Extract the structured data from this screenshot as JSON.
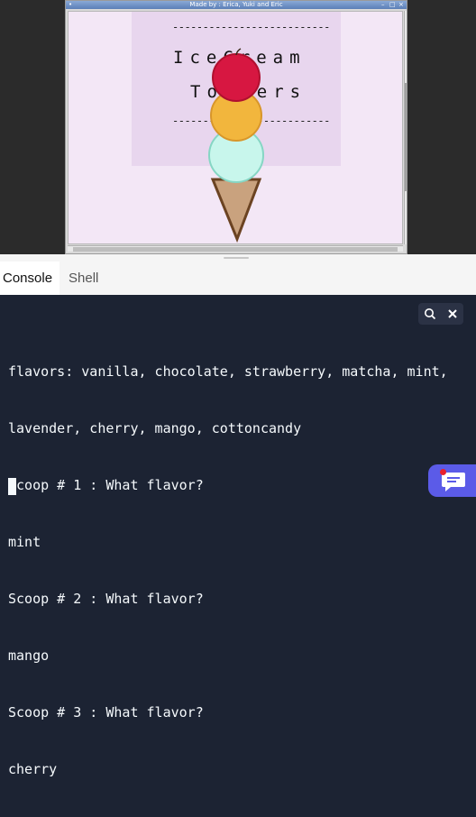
{
  "turtle_window": {
    "title": "Made by : Erica, Yuki and Eric",
    "dash_line": "--------------------------",
    "title_line1": "IceCream",
    "title_line2": "Toppers",
    "colors": {
      "canvas_bg": "#f3e7f6",
      "panel_bg": "#e8d6ee",
      "cherry_scoop": "#d71741",
      "mango_scoop": "#f2b63d",
      "mint_scoop": "#c8f6ec",
      "cone": "#c9a27e",
      "cone_outline": "#6b4322"
    }
  },
  "tabs": [
    {
      "label": "Console",
      "active": true
    },
    {
      "label": "Shell",
      "active": false
    }
  ],
  "console": {
    "lines": [
      "flavors: vanilla, chocolate, strawberry, matcha, mint,",
      "lavender, cherry, mango, cottoncandy",
      "Scoop # 1 : What flavor?",
      "mint",
      "Scoop # 2 : What flavor?",
      "mango",
      "Scoop # 3 : What flavor?",
      "cherry"
    ],
    "tools": {
      "search_icon": "search-icon",
      "close_icon": "close-icon"
    }
  },
  "chat": {
    "icon": "chat-icon",
    "has_notification": true
  }
}
